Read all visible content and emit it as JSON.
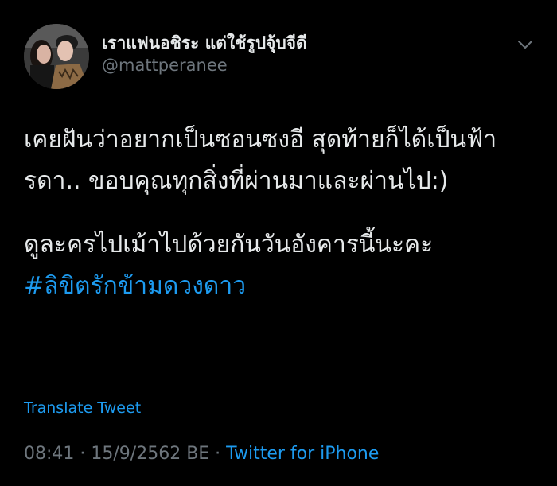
{
  "user": {
    "display_name": "เราแฟนอชิระ แต่ใช้รูปจุ้บจีดี",
    "handle": "@mattperanee"
  },
  "tweet": {
    "paragraph_1": "เคยฝันว่าอยากเป็นซอนซงอี สุดท้ายก็ได้เป็นฟ้ารดา.. ขอบคุณทุกสิ่งที่ผ่านมาและผ่านไป:)",
    "paragraph_2": "ดูละครไปเม้าไปด้วยกันวันอังคารนี้นะคะ",
    "hashtag": "#ลิขิตรักข้ามดวงดาว"
  },
  "translate_label": "Translate Tweet",
  "meta": {
    "time": "08:41",
    "separator_1": " · ",
    "date": "15/9/2562 BE",
    "separator_2": " · ",
    "source": "Twitter for iPhone"
  },
  "colors": {
    "background": "#000000",
    "text": "#e6e9ea",
    "secondary": "#6e767d",
    "link": "#1d9bf0"
  },
  "icons": {
    "avatar": "profile-photo",
    "menu": "chevron-down-icon"
  }
}
